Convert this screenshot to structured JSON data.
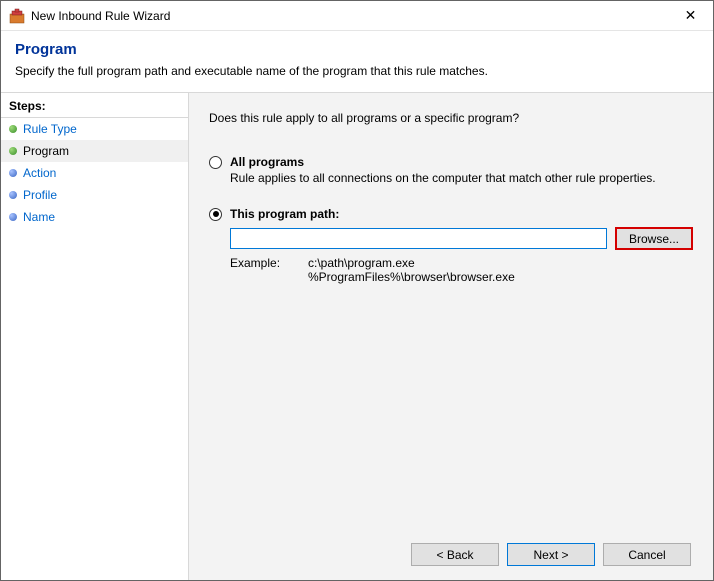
{
  "window": {
    "title": "New Inbound Rule Wizard",
    "close_glyph": "✕"
  },
  "header": {
    "title": "Program",
    "subtitle": "Specify the full program path and executable name of the program that this rule matches."
  },
  "sidebar": {
    "label": "Steps:",
    "steps": [
      {
        "label": "Rule Type"
      },
      {
        "label": "Program"
      },
      {
        "label": "Action"
      },
      {
        "label": "Profile"
      },
      {
        "label": "Name"
      }
    ]
  },
  "content": {
    "question": "Does this rule apply to all programs or a specific program?",
    "options": {
      "all": {
        "label": "All programs",
        "desc": "Rule applies to all connections on the computer that match other rule properties."
      },
      "path": {
        "label": "This program path:",
        "value": "",
        "browse": "Browse...",
        "example_label": "Example:",
        "example_text": "c:\\path\\program.exe\n%ProgramFiles%\\browser\\browser.exe"
      }
    }
  },
  "footer": {
    "back": "< Back",
    "next": "Next >",
    "cancel": "Cancel"
  }
}
